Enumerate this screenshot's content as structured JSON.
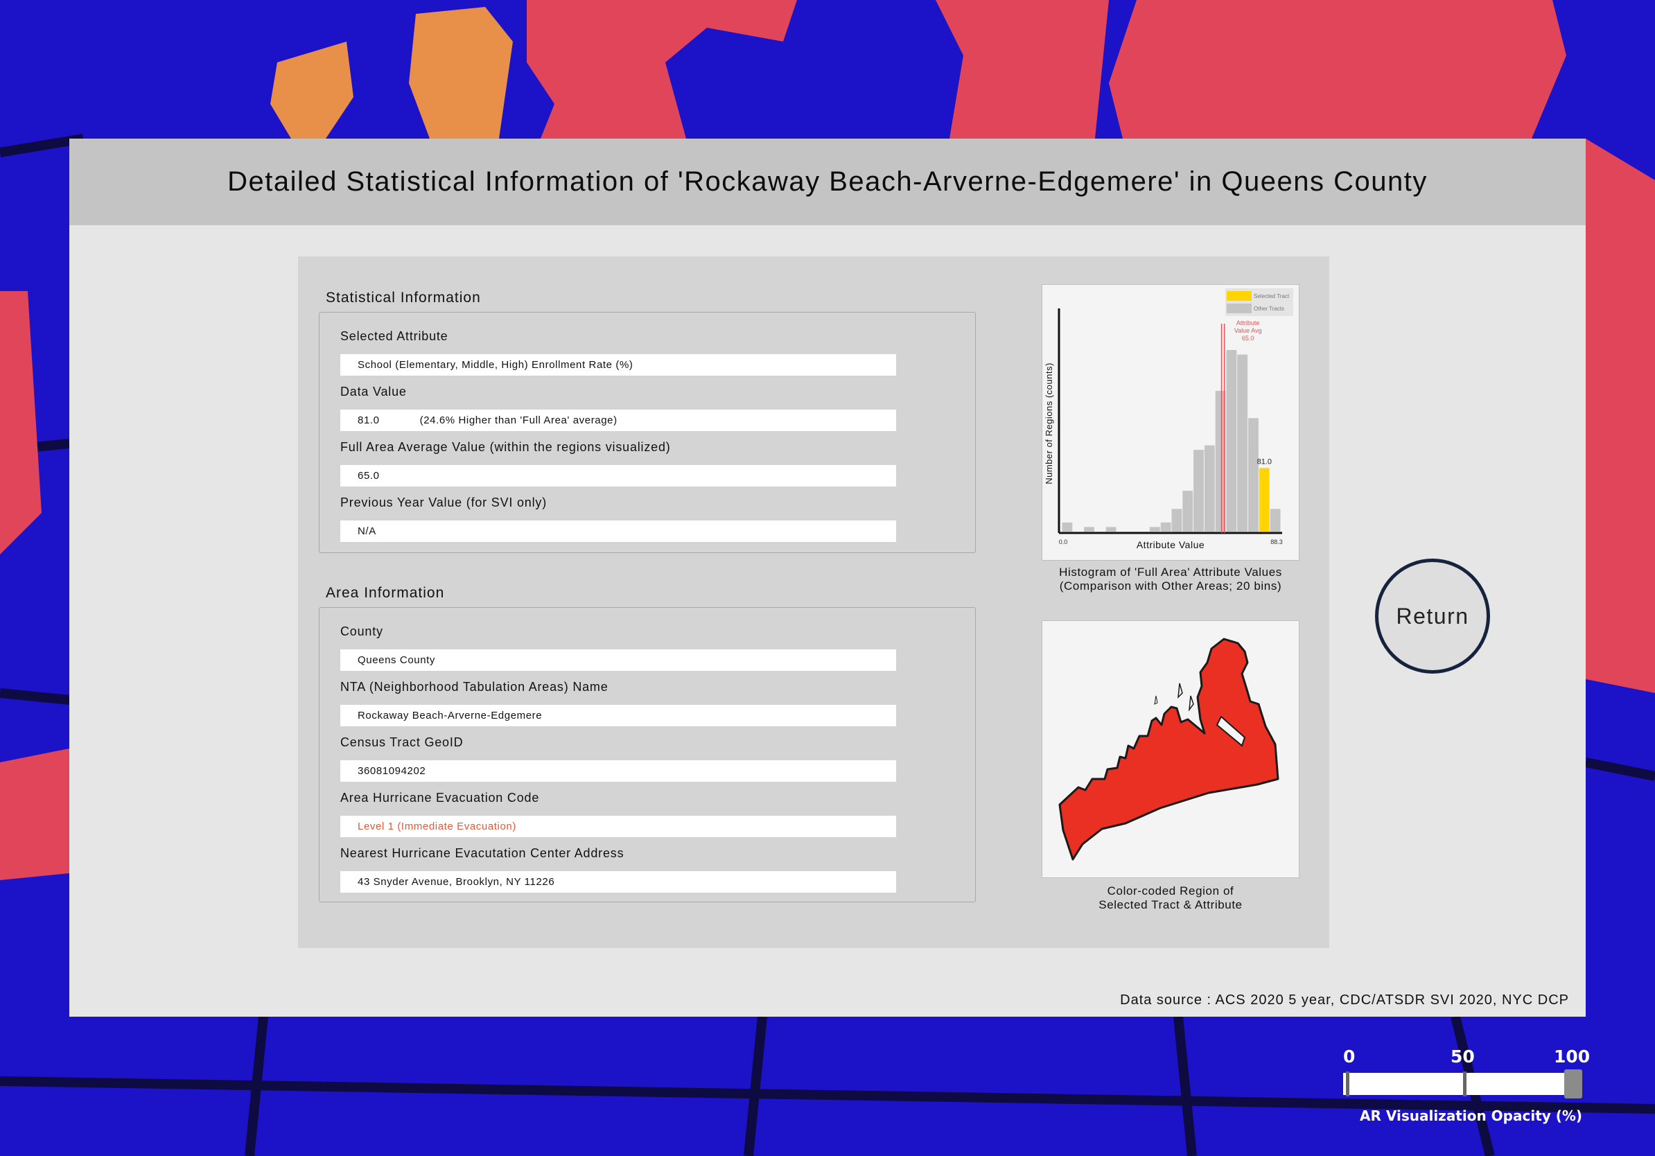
{
  "title": "Detailed Statistical Information of 'Rockaway Beach-Arverne-Edgemere' in Queens County",
  "colors": {
    "background_water": "#1c12c8",
    "map_region": "#e0455a",
    "selected_region": "#e93022",
    "selected_tract": "#ffd400",
    "other_tracts": "#c4c4c4",
    "average_line": "#e05555",
    "alert_text": "#e05a3a"
  },
  "statistical_information": {
    "section_title": "Statistical Information",
    "fields": [
      {
        "label": "Selected Attribute",
        "value": "School (Elementary, Middle, High) Enrollment Rate (%)",
        "note": ""
      },
      {
        "label": "Data Value",
        "value": "81.0",
        "note": "(24.6% Higher than 'Full Area' average)"
      },
      {
        "label": "Full Area Average Value (within the regions visualized)",
        "value": "65.0",
        "note": ""
      },
      {
        "label": "Previous Year Value (for SVI only)",
        "value": "N/A",
        "note": ""
      }
    ]
  },
  "area_information": {
    "section_title": "Area Information",
    "fields": [
      {
        "label": "County",
        "value": "Queens County"
      },
      {
        "label": "NTA (Neighborhood Tabulation Areas) Name",
        "value": "Rockaway Beach-Arverne-Edgemere"
      },
      {
        "label": "Census Tract GeoID",
        "value": "36081094202"
      },
      {
        "label": "Area Hurricane Evacuation Code",
        "value": "Level 1 (Immediate Evacuation)"
      },
      {
        "label": "Nearest Hurricane Evacutation Center Address",
        "value": "43 Snyder Avenue, Brooklyn, NY 11226"
      }
    ]
  },
  "histogram": {
    "caption_line1": "Histogram of 'Full Area' Attribute Values",
    "caption_line2": "(Comparison with Other Areas; 20 bins)"
  },
  "chart_data": {
    "type": "bar",
    "xlabel": "Attribute Value",
    "ylabel": "Number of Regions (counts)",
    "xlim": [
      0.0,
      88.3
    ],
    "x_tick_labels": [
      "0.0",
      "88.3"
    ],
    "bins": 20,
    "bin_width": 4.415,
    "counts": [
      2,
      0,
      1,
      0,
      1,
      0,
      0,
      0,
      1,
      2,
      5,
      9,
      18,
      19,
      31,
      40,
      39,
      25,
      14,
      5
    ],
    "selected_bin_index": 18,
    "selected_value": 81.0,
    "selected_value_label": "81.0",
    "average_value": 65.0,
    "average_label_lines": [
      "Attribute",
      "Value Avg",
      "65.0"
    ],
    "legend": [
      {
        "name": "Selected Tract",
        "color": "#ffd400"
      },
      {
        "name": "Other Tracts",
        "color": "#c4c4c4"
      }
    ],
    "legend_position": "top-right"
  },
  "region_map": {
    "caption_line1": "Color-coded Region of",
    "caption_line2": "Selected Tract & Attribute"
  },
  "return_button": "Return",
  "data_source": "Data source : ACS 2020 5 year, CDC/ATSDR SVI 2020, NYC DCP",
  "opacity_slider": {
    "tick_labels": [
      "0",
      "50",
      "100"
    ],
    "tick_values": [
      0,
      50,
      100
    ],
    "value_percent": 100,
    "caption": "AR Visualization Opacity (%)"
  }
}
